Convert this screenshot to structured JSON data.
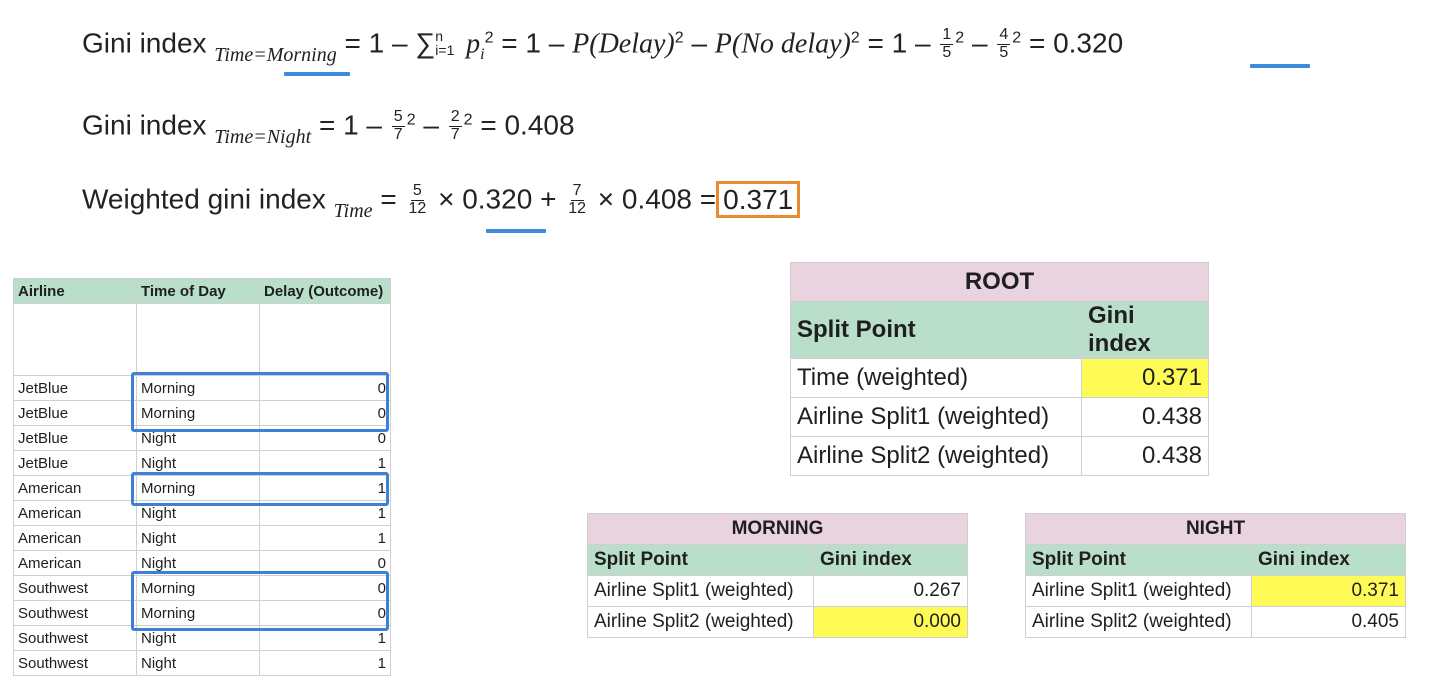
{
  "formulas": {
    "morning": {
      "lead": "Gini index",
      "subscript": "Time=Morning",
      "eq1": "= 1 –",
      "sum_symbol": "∑",
      "sum_upper": "n",
      "sum_lower": "i=1",
      "p_term": "p",
      "p_sub": "i",
      "exp": "2",
      "eq2": "= 1 –",
      "p_delay": "P(Delay)",
      "minus": "–",
      "p_nodelay": "P(No delay)",
      "eq3": "= 1 –",
      "f1_num": "1",
      "f1_den": "5",
      "f2_num": "4",
      "f2_den": "5",
      "eq4": "=",
      "result": "0.320"
    },
    "night": {
      "lead": "Gini index",
      "subscript": "Time=Night",
      "eq1": "= 1 –",
      "f1_num": "5",
      "f1_den": "7",
      "exp": "2",
      "minus": "–",
      "f2_num": "2",
      "f2_den": "7",
      "eq2": "=",
      "result": "0.408"
    },
    "weighted": {
      "lead": "Weighted gini index",
      "subscript": "Time",
      "eq1": "=",
      "f1_num": "5",
      "f1_den": "12",
      "times": "×",
      "v1": "0.320",
      "plus": "+",
      "f2_num": "7",
      "f2_den": "12",
      "v2": "0.408",
      "eq2": "=",
      "result": "0.371"
    }
  },
  "flight_table": {
    "headers": [
      "Airline",
      "Time of Day",
      "Delay (Outcome)"
    ],
    "rows": [
      [
        "JetBlue",
        "Morning",
        "0"
      ],
      [
        "JetBlue",
        "Morning",
        "0"
      ],
      [
        "JetBlue",
        "Night",
        "0"
      ],
      [
        "JetBlue",
        "Night",
        "1"
      ],
      [
        "American",
        "Morning",
        "1"
      ],
      [
        "American",
        "Night",
        "1"
      ],
      [
        "American",
        "Night",
        "1"
      ],
      [
        "American",
        "Night",
        "0"
      ],
      [
        "Southwest",
        "Morning",
        "0"
      ],
      [
        "Southwest",
        "Morning",
        "0"
      ],
      [
        "Southwest",
        "Night",
        "1"
      ],
      [
        "Southwest",
        "Night",
        "1"
      ]
    ]
  },
  "root_table": {
    "title": "ROOT",
    "col_split": "Split Point",
    "col_gini": "Gini index",
    "rows": [
      {
        "split": "Time (weighted)",
        "gini": "0.371"
      },
      {
        "split": "Airline Split1 (weighted)",
        "gini": "0.438"
      },
      {
        "split": "Airline Split2 (weighted)",
        "gini": "0.438"
      }
    ]
  },
  "morning_table": {
    "title": "MORNING",
    "col_split": "Split Point",
    "col_gini": "Gini index",
    "rows": [
      {
        "split": "Airline Split1 (weighted)",
        "gini": "0.267"
      },
      {
        "split": "Airline Split2 (weighted)",
        "gini": "0.000"
      }
    ]
  },
  "night_table": {
    "title": "NIGHT",
    "col_split": "Split Point",
    "col_gini": "Gini index",
    "rows": [
      {
        "split": "Airline Split1 (weighted)",
        "gini": "0.371"
      },
      {
        "split": "Airline Split2 (weighted)",
        "gini": "0.405"
      }
    ]
  },
  "colors": {
    "highlight": "#fefb57",
    "header_green": "#b9dfcb",
    "header_pink": "#e8d3de",
    "selection_blue": "#3d7fd9",
    "result_orange": "#e98c2f"
  }
}
